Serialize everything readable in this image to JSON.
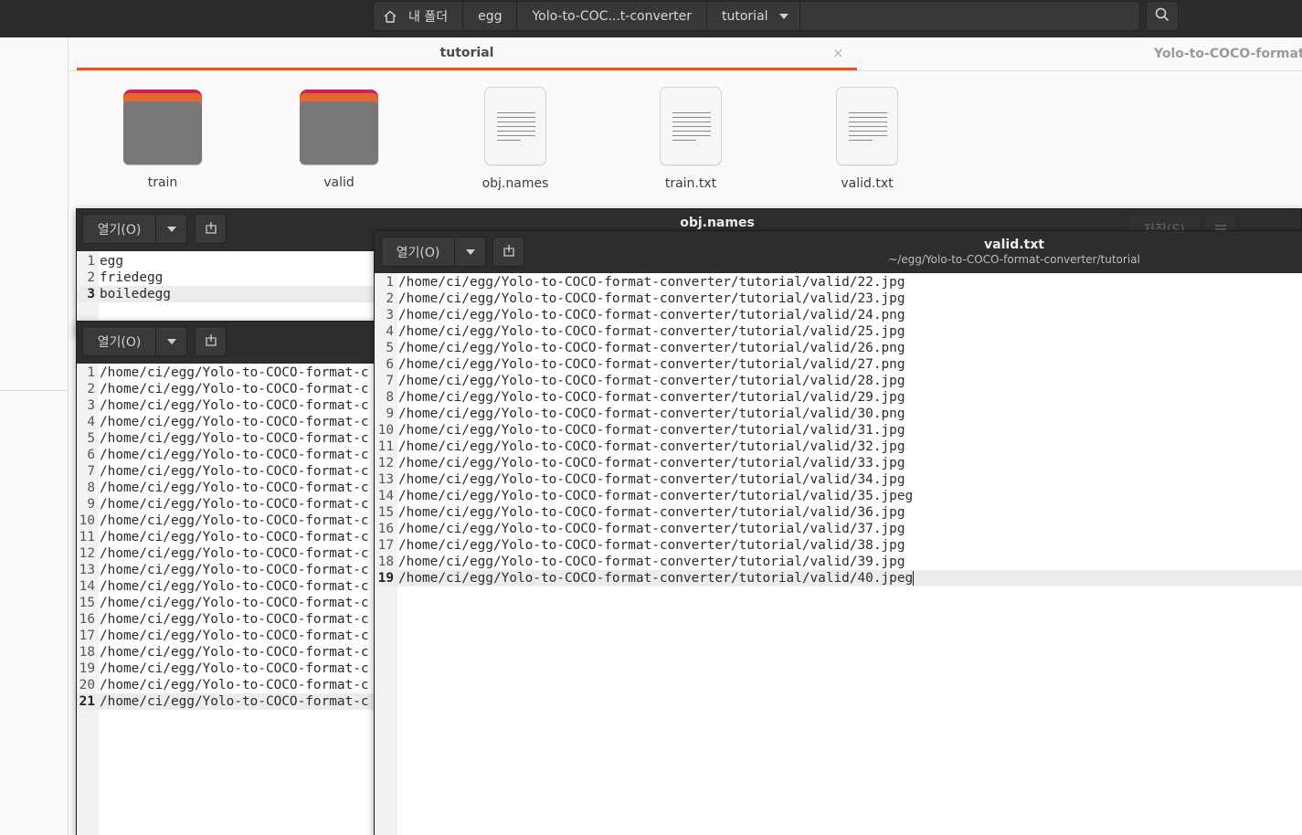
{
  "pathbar": {
    "crumbs": [
      "내 폴더",
      "egg",
      "Yolo-to-COC...t-converter",
      "tutorial"
    ]
  },
  "file_manager": {
    "tabs": [
      "tutorial",
      "Yolo-to-COCO-format-c"
    ],
    "close_glyph": "×",
    "items": [
      {
        "name": "train",
        "type": "folder"
      },
      {
        "name": "valid",
        "type": "folder"
      },
      {
        "name": "obj.names",
        "type": "text-file"
      },
      {
        "name": "train.txt",
        "type": "text-file"
      },
      {
        "name": "valid.txt",
        "type": "text-file"
      }
    ],
    "colors": {
      "accent": "#e95420",
      "folder_back": "#c9245f",
      "folder_front": "#777777"
    }
  },
  "editor_obj": {
    "title": "obj.names",
    "open_label": "열기(O)",
    "save_label": "저장(S)",
    "lines": [
      "egg",
      "friedegg",
      "boiledegg"
    ],
    "current_line": 3
  },
  "editor_train": {
    "open_label": "열기(O)",
    "line_prefix": "/home/ci/egg/Yolo-to-COCO-format-c",
    "line_count": 21,
    "current_line": 21
  },
  "editor_valid": {
    "title": "valid.txt",
    "subtitle": "~/egg/Yolo-to-COCO-format-converter/tutorial",
    "open_label": "열기(O)",
    "lines": [
      "/home/ci/egg/Yolo-to-COCO-format-converter/tutorial/valid/22.jpg",
      "/home/ci/egg/Yolo-to-COCO-format-converter/tutorial/valid/23.jpg",
      "/home/ci/egg/Yolo-to-COCO-format-converter/tutorial/valid/24.png",
      "/home/ci/egg/Yolo-to-COCO-format-converter/tutorial/valid/25.jpg",
      "/home/ci/egg/Yolo-to-COCO-format-converter/tutorial/valid/26.png",
      "/home/ci/egg/Yolo-to-COCO-format-converter/tutorial/valid/27.png",
      "/home/ci/egg/Yolo-to-COCO-format-converter/tutorial/valid/28.jpg",
      "/home/ci/egg/Yolo-to-COCO-format-converter/tutorial/valid/29.jpg",
      "/home/ci/egg/Yolo-to-COCO-format-converter/tutorial/valid/30.png",
      "/home/ci/egg/Yolo-to-COCO-format-converter/tutorial/valid/31.jpg",
      "/home/ci/egg/Yolo-to-COCO-format-converter/tutorial/valid/32.jpg",
      "/home/ci/egg/Yolo-to-COCO-format-converter/tutorial/valid/33.jpg",
      "/home/ci/egg/Yolo-to-COCO-format-converter/tutorial/valid/34.jpg",
      "/home/ci/egg/Yolo-to-COCO-format-converter/tutorial/valid/35.jpeg",
      "/home/ci/egg/Yolo-to-COCO-format-converter/tutorial/valid/36.jpg",
      "/home/ci/egg/Yolo-to-COCO-format-converter/tutorial/valid/37.jpg",
      "/home/ci/egg/Yolo-to-COCO-format-converter/tutorial/valid/38.jpg",
      "/home/ci/egg/Yolo-to-COCO-format-converter/tutorial/valid/39.jpg",
      "/home/ci/egg/Yolo-to-COCO-format-converter/tutorial/valid/40.jpeg"
    ],
    "current_line": 19
  }
}
